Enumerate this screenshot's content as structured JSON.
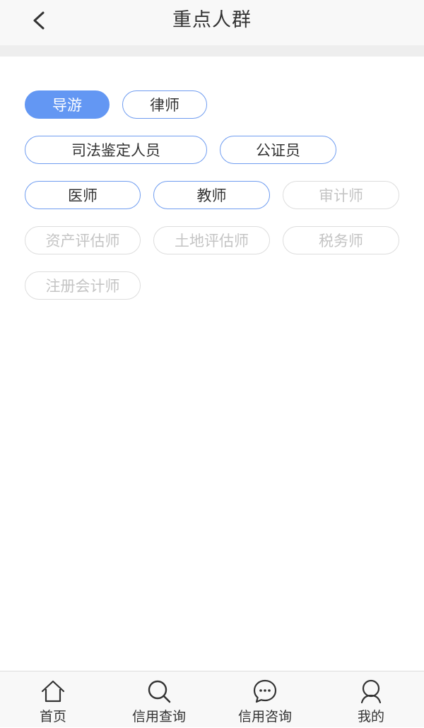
{
  "header": {
    "title": "重点人群"
  },
  "tags": [
    {
      "label": "导游",
      "state": "selected"
    },
    {
      "label": "律师",
      "state": "active"
    },
    {
      "label": "司法鉴定人员",
      "state": "active"
    },
    {
      "label": "公证员",
      "state": "active"
    },
    {
      "label": "医师",
      "state": "active"
    },
    {
      "label": "教师",
      "state": "active"
    },
    {
      "label": "审计师",
      "state": "disabled"
    },
    {
      "label": "资产评估师",
      "state": "disabled"
    },
    {
      "label": "土地评估师",
      "state": "disabled"
    },
    {
      "label": "税务师",
      "state": "disabled"
    },
    {
      "label": "注册会计师",
      "state": "disabled"
    }
  ],
  "tabbar": {
    "items": [
      {
        "label": "首页",
        "icon": "home-icon"
      },
      {
        "label": "信用查询",
        "icon": "search-icon"
      },
      {
        "label": "信用咨询",
        "icon": "chat-icon"
      },
      {
        "label": "我的",
        "icon": "user-icon"
      }
    ]
  },
  "colors": {
    "accent": "#6397f3",
    "tag_border": "#6f9cf0",
    "disabled_text": "#c4c4c4",
    "disabled_border": "#dddddd"
  }
}
